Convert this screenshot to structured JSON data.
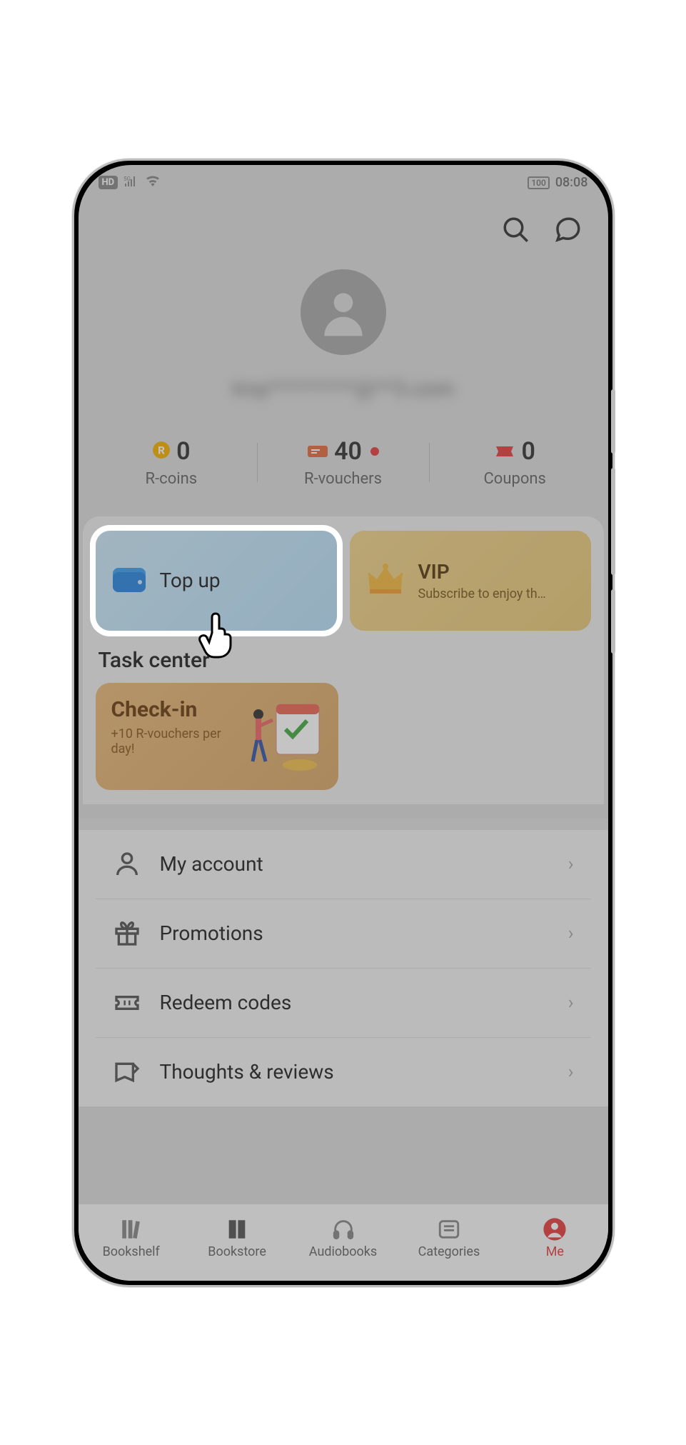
{
  "status": {
    "hd": "HD",
    "network": "5G",
    "battery": "100",
    "time": "08:08"
  },
  "profile": {
    "username_obscured": "troy*********@**3.com"
  },
  "stats": {
    "rcoins": {
      "value": "0",
      "label": "R-coins"
    },
    "rvouchers": {
      "value": "40",
      "label": "R-vouchers",
      "has_dot": true
    },
    "coupons": {
      "value": "0",
      "label": "Coupons"
    }
  },
  "cards": {
    "topup": {
      "title": "Top up"
    },
    "vip": {
      "title": "VIP",
      "subtitle": "Subscribe to enjoy th…"
    }
  },
  "task_center": {
    "heading": "Task center",
    "checkin": {
      "title": "Check-in",
      "subtitle": "+10 R-vouchers per day!"
    }
  },
  "menu": {
    "account": "My account",
    "promotions": "Promotions",
    "redeem": "Redeem codes",
    "thoughts": "Thoughts & reviews"
  },
  "nav": {
    "bookshelf": "Bookshelf",
    "bookstore": "Bookstore",
    "audiobooks": "Audiobooks",
    "categories": "Categories",
    "me": "Me"
  }
}
